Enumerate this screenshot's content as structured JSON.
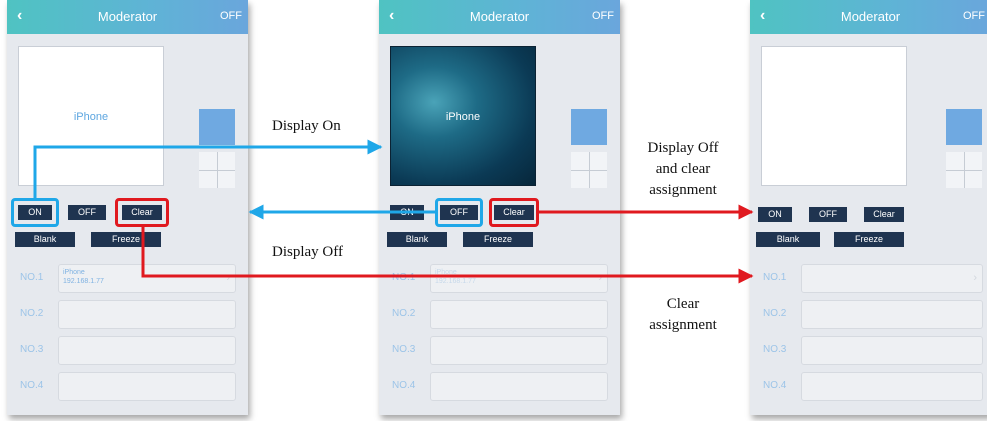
{
  "header": {
    "back_icon": "‹",
    "title": "Moderator",
    "status": "OFF"
  },
  "screens": [
    {
      "preview_label": "iPhone",
      "preview_style": "white",
      "rows": [
        {
          "label": "NO.1",
          "device_name": "iPhone",
          "device_ip": "192.168.1.77"
        },
        {
          "label": "NO.2"
        },
        {
          "label": "NO.3"
        },
        {
          "label": "NO.4"
        }
      ]
    },
    {
      "preview_label": "iPhone",
      "preview_style": "dark",
      "rows": [
        {
          "label": "NO.1",
          "device_name": "iPhone",
          "device_ip": "192.168.1.77"
        },
        {
          "label": "NO.2"
        },
        {
          "label": "NO.3"
        },
        {
          "label": "NO.4"
        }
      ]
    },
    {
      "preview_label": "",
      "preview_style": "white",
      "rows": [
        {
          "label": "NO.1"
        },
        {
          "label": "NO.2"
        },
        {
          "label": "NO.3"
        },
        {
          "label": "NO.4"
        }
      ]
    }
  ],
  "buttons": {
    "on": "ON",
    "off": "OFF",
    "clear": "Clear",
    "blank": "Blank",
    "freeze": "Freeze"
  },
  "annotations": {
    "display_on": "Display On",
    "display_off": "Display Off",
    "display_off_clear": [
      "Display Off",
      "and clear",
      "assignment"
    ],
    "clear_assignment": [
      "Clear",
      "assignment"
    ]
  },
  "colors": {
    "blue_arrow": "#1fa7e8",
    "red_arrow": "#e0191f",
    "header_start": "#4fc3c2",
    "header_end": "#6aa6dc",
    "button": "#1f3450"
  },
  "icons": {
    "back": "chevron-left-icon",
    "row_chevron": "chevron-right-icon"
  }
}
